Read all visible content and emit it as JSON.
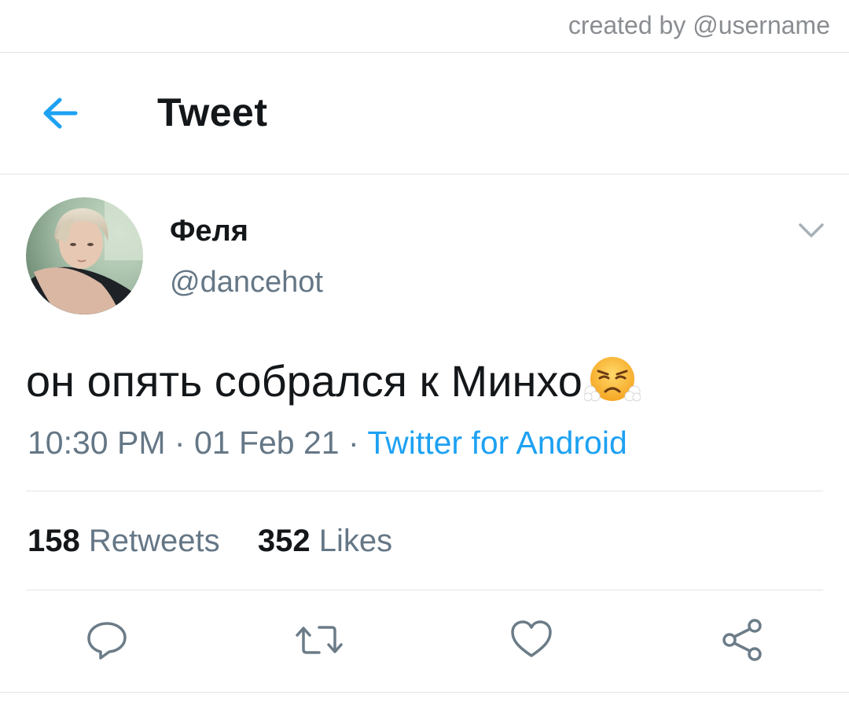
{
  "credit": "created by @username",
  "header": {
    "title": "Tweet",
    "back_icon": "back-arrow-icon",
    "accent": "#1da1f2"
  },
  "tweet": {
    "display_name": "Феля",
    "handle": "@dancehot",
    "text": "он опять собрался к Минхо",
    "emoji": "face-with-steam-from-nose",
    "time": "10:30 PM",
    "separator": "·",
    "date": "01 Feb 21",
    "source": "Twitter for Android",
    "more_icon": "chevron-down-icon"
  },
  "stats": {
    "retweets_count": "158",
    "retweets_label": "Retweets",
    "likes_count": "352",
    "likes_label": "Likes"
  },
  "actions": [
    {
      "icon": "reply-icon"
    },
    {
      "icon": "retweet-icon"
    },
    {
      "icon": "like-icon"
    },
    {
      "icon": "share-icon"
    }
  ],
  "colors": {
    "text": "#14171a",
    "secondary": "#657786",
    "link": "#1da1f2",
    "divider": "#e1e4e6"
  }
}
